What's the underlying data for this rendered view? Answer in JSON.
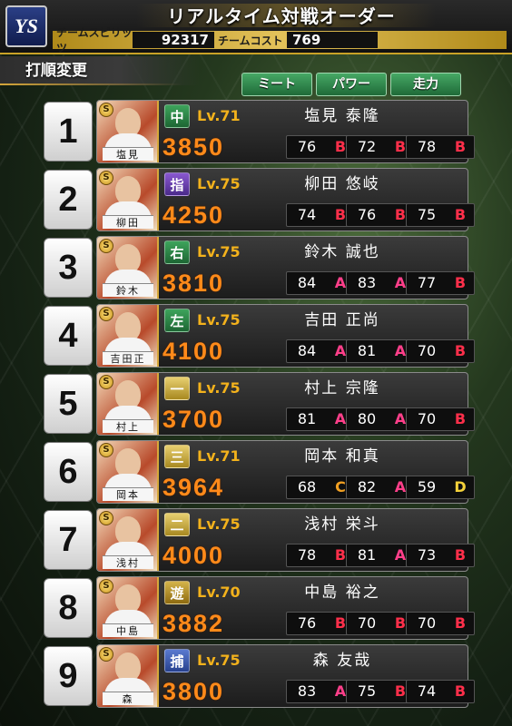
{
  "header": {
    "logo_text": "YS",
    "title": "リアルタイム対戦オーダー",
    "team_spirits_label": "チームスピリッツ",
    "team_spirits_value": "92317",
    "team_cost_label": "チームコスト",
    "team_cost_value": "769"
  },
  "subheader": {
    "title": "打順変更"
  },
  "sort_buttons": [
    {
      "label": "ミート"
    },
    {
      "label": "パワー"
    },
    {
      "label": "走力"
    }
  ],
  "rank_colors": {
    "A": "#ff3f8a",
    "B": "#ff2f4a",
    "C": "#f2a022",
    "D": "#f5d23a"
  },
  "lineup": [
    {
      "order": "1",
      "position": "中",
      "pos_class": "c",
      "level": "Lv.71",
      "name": "塩見 泰隆",
      "plate": "塩見",
      "power": "3850",
      "stats": [
        {
          "value": "76",
          "rank": "B"
        },
        {
          "value": "72",
          "rank": "B"
        },
        {
          "value": "78",
          "rank": "B"
        }
      ]
    },
    {
      "order": "2",
      "position": "指",
      "pos_class": "dh",
      "level": "Lv.75",
      "name": "柳田 悠岐",
      "plate": "柳田",
      "power": "4250",
      "stats": [
        {
          "value": "74",
          "rank": "B"
        },
        {
          "value": "76",
          "rank": "B"
        },
        {
          "value": "75",
          "rank": "B"
        }
      ]
    },
    {
      "order": "3",
      "position": "右",
      "pos_class": "c",
      "level": "Lv.75",
      "name": "鈴木 誠也",
      "plate": "鈴木",
      "power": "3810",
      "stats": [
        {
          "value": "84",
          "rank": "A"
        },
        {
          "value": "83",
          "rank": "A"
        },
        {
          "value": "77",
          "rank": "B"
        }
      ]
    },
    {
      "order": "4",
      "position": "左",
      "pos_class": "c",
      "level": "Lv.75",
      "name": "吉田 正尚",
      "plate": "吉田正",
      "power": "4100",
      "stats": [
        {
          "value": "84",
          "rank": "A"
        },
        {
          "value": "81",
          "rank": "A"
        },
        {
          "value": "70",
          "rank": "B"
        }
      ]
    },
    {
      "order": "5",
      "position": "一",
      "pos_class": "sc",
      "level": "Lv.75",
      "name": "村上 宗隆",
      "plate": "村上",
      "power": "3700",
      "stats": [
        {
          "value": "81",
          "rank": "A"
        },
        {
          "value": "80",
          "rank": "A"
        },
        {
          "value": "70",
          "rank": "B"
        }
      ]
    },
    {
      "order": "6",
      "position": "三",
      "pos_class": "sc",
      "level": "Lv.71",
      "name": "岡本 和真",
      "plate": "岡本",
      "power": "3964",
      "stats": [
        {
          "value": "68",
          "rank": "C"
        },
        {
          "value": "82",
          "rank": "A"
        },
        {
          "value": "59",
          "rank": "D"
        }
      ]
    },
    {
      "order": "7",
      "position": "二",
      "pos_class": "sc",
      "level": "Lv.75",
      "name": "浅村 栄斗",
      "plate": "浅村",
      "power": "4000",
      "stats": [
        {
          "value": "78",
          "rank": "B"
        },
        {
          "value": "81",
          "rank": "A"
        },
        {
          "value": "73",
          "rank": "B"
        }
      ]
    },
    {
      "order": "8",
      "position": "遊",
      "pos_class": "ss",
      "level": "Lv.70",
      "name": "中島 裕之",
      "plate": "中島",
      "power": "3882",
      "stats": [
        {
          "value": "76",
          "rank": "B"
        },
        {
          "value": "70",
          "rank": "B"
        },
        {
          "value": "70",
          "rank": "B"
        }
      ]
    },
    {
      "order": "9",
      "position": "捕",
      "pos_class": "ca",
      "level": "Lv.75",
      "name": "森 友哉",
      "plate": "森",
      "power": "3800",
      "stats": [
        {
          "value": "83",
          "rank": "A"
        },
        {
          "value": "75",
          "rank": "B"
        },
        {
          "value": "74",
          "rank": "B"
        }
      ]
    }
  ]
}
